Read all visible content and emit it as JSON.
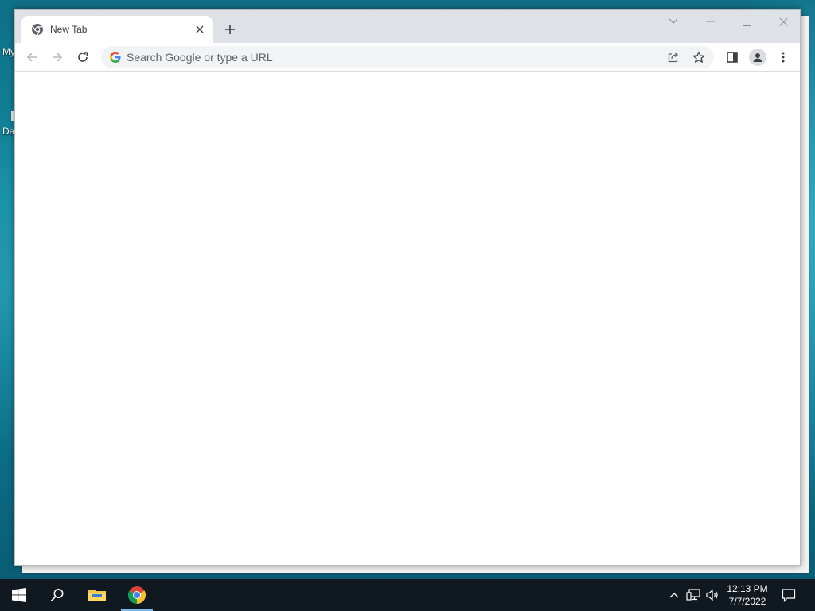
{
  "desktop": {
    "labels": [
      "My",
      "Da"
    ]
  },
  "browser": {
    "tabs": [
      {
        "title": "New Tab",
        "favicon": "chrome-icon"
      }
    ],
    "omnibox": {
      "placeholder": "Search Google or type a URL",
      "value": ""
    },
    "toolbar": {
      "back": "back-arrow-icon",
      "forward": "forward-arrow-icon",
      "reload": "reload-icon",
      "share": "share-icon",
      "bookmark": "star-icon",
      "side_panel": "side-panel-icon",
      "profile": "profile-avatar-icon",
      "menu": "kebab-menu-icon"
    },
    "window_controls": [
      "tab-search",
      "minimize",
      "maximize",
      "close"
    ]
  },
  "taskbar": {
    "pinned": [
      "start",
      "search",
      "file-explorer",
      "chrome"
    ],
    "active": "chrome",
    "clock": {
      "time": "12:13 PM",
      "date": "7/7/2022"
    }
  },
  "colors": {
    "tabstrip": "#dee1e6",
    "omnibox": "#f1f3f4",
    "taskbar": "#101820",
    "active_indicator": "#76b9ed"
  }
}
